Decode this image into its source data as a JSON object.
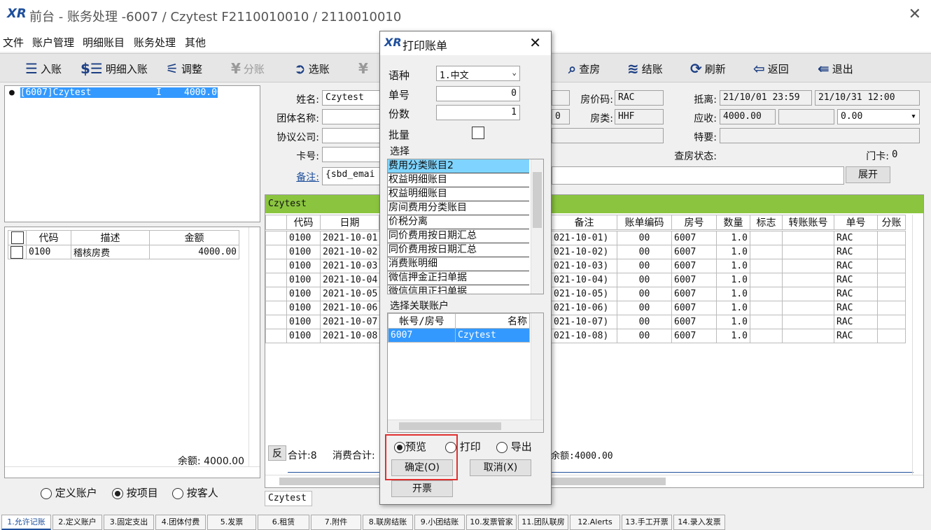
{
  "window": {
    "title": "前台 - 账务处理 -6007  /  Czytest  F2110010010  /  2110010010",
    "logo": "XR"
  },
  "menu": [
    "文件",
    "账户管理",
    "明细账目",
    "账务处理",
    "其他"
  ],
  "toolbar": {
    "in": "入账",
    "detail_in": "明细入账",
    "adjust": "调整",
    "split": "分账",
    "select": "选账",
    "check_room": "查房",
    "checkout": "结账",
    "refresh": "刷新",
    "back": "返回",
    "exit": "退出"
  },
  "tree": {
    "item": "[6007]Czytest",
    "flag": "I",
    "amount": "4000.00"
  },
  "left_grid": {
    "headers": [
      "代码",
      "描述",
      "金额"
    ],
    "rows": [
      {
        "code": "0100",
        "desc": "稽核房费",
        "amount": "4000.00"
      }
    ],
    "balance": "余额: 4000.00"
  },
  "left_radios": {
    "account": "定义账户",
    "item": "按项目",
    "guest": "按客人"
  },
  "info": {
    "name_lbl": "姓名:",
    "name": "Czytest",
    "group_lbl": "团体名称:",
    "agreement_lbl": "协议公司:",
    "card_lbl": "卡号:",
    "remark_lbl": "备注:",
    "remark": "{sbd_emai",
    "rate_code_lbl": "房价码:",
    "rate_code": "RAC",
    "room_type_lbl": "房类:",
    "room_type": "HHF",
    "room_type_prefix": "0",
    "arrive_lbl": "抵离:",
    "arrive": "21/10/01 23:59",
    "depart": "21/10/31 12:00",
    "receivable_lbl": "应收:",
    "receivable": "4000.00",
    "receivable2": "0.00",
    "special_lbl": "特要:",
    "check_status_lbl": "查房状态:",
    "door_card_lbl": "门卡:",
    "door_card": "0",
    "expand": "展开"
  },
  "main_grid": {
    "account_name": "Czytest",
    "headers_left": [
      "代码",
      "日期"
    ],
    "headers_right": [
      "备注",
      "账单编码",
      "房号",
      "数量",
      "标志",
      "转账账号",
      "单号",
      "分账"
    ],
    "rows": [
      {
        "code": "0100",
        "date": "2021-10-01",
        "note": "021-10-01)",
        "bill": "00",
        "room": "6007",
        "qty": "1.0",
        "no": "RAC"
      },
      {
        "code": "0100",
        "date": "2021-10-02",
        "note": "021-10-02)",
        "bill": "00",
        "room": "6007",
        "qty": "1.0",
        "no": "RAC"
      },
      {
        "code": "0100",
        "date": "2021-10-03",
        "note": "021-10-03)",
        "bill": "00",
        "room": "6007",
        "qty": "1.0",
        "no": "RAC"
      },
      {
        "code": "0100",
        "date": "2021-10-04",
        "note": "021-10-04)",
        "bill": "00",
        "room": "6007",
        "qty": "1.0",
        "no": "RAC"
      },
      {
        "code": "0100",
        "date": "2021-10-05",
        "note": "021-10-05)",
        "bill": "00",
        "room": "6007",
        "qty": "1.0",
        "no": "RAC"
      },
      {
        "code": "0100",
        "date": "2021-10-06",
        "note": "021-10-06)",
        "bill": "00",
        "room": "6007",
        "qty": "1.0",
        "no": "RAC"
      },
      {
        "code": "0100",
        "date": "2021-10-07",
        "note": "021-10-07)",
        "bill": "00",
        "room": "6007",
        "qty": "1.0",
        "no": "RAC"
      },
      {
        "code": "0100",
        "date": "2021-10-08",
        "note": "021-10-08)",
        "bill": "00",
        "room": "6007",
        "qty": "1.0",
        "no": "RAC"
      }
    ],
    "reverse": "反",
    "total": "合计:8",
    "consume_total": "消费合计:",
    "balance": "余额:4000.00",
    "footer_tab": "Czytest"
  },
  "dialog": {
    "title": "打印账单",
    "lang_lbl": "语种",
    "lang_val": "1.中文",
    "no_lbl": "单号",
    "no_val": "0",
    "copies_lbl": "份数",
    "copies_val": "1",
    "batch_lbl": "批量",
    "choose_lbl": "选择",
    "choose_items": [
      "费用分类账目2",
      "权益明细账目",
      "权益明细账目",
      "房间费用分类账目",
      "价税分离",
      "同价费用按日期汇总",
      "同价费用按日期汇总",
      "消费账明细",
      "微信押金正扫单据",
      "微信信用正扫单据"
    ],
    "assoc_lbl": "选择关联账户",
    "assoc_headers": [
      "帐号/房号",
      "名称"
    ],
    "assoc_rows": [
      {
        "acct": "6007",
        "name": "Czytest"
      }
    ],
    "preview": "预览",
    "print": "打印",
    "export": "导出",
    "ok": "确定(O)",
    "cancel": "取消(X)",
    "invoice": "开票"
  },
  "tabs": [
    "1.允许记账",
    "2.定义账户",
    "3.固定支出",
    "4.团体付费",
    "5.发票",
    "6.租赁",
    "7.附件",
    "8.联房结账",
    "9.小团结账",
    "10.发票管家",
    "11.团队联房",
    "12.Alerts",
    "13.手工开票",
    "14.录入发票"
  ]
}
